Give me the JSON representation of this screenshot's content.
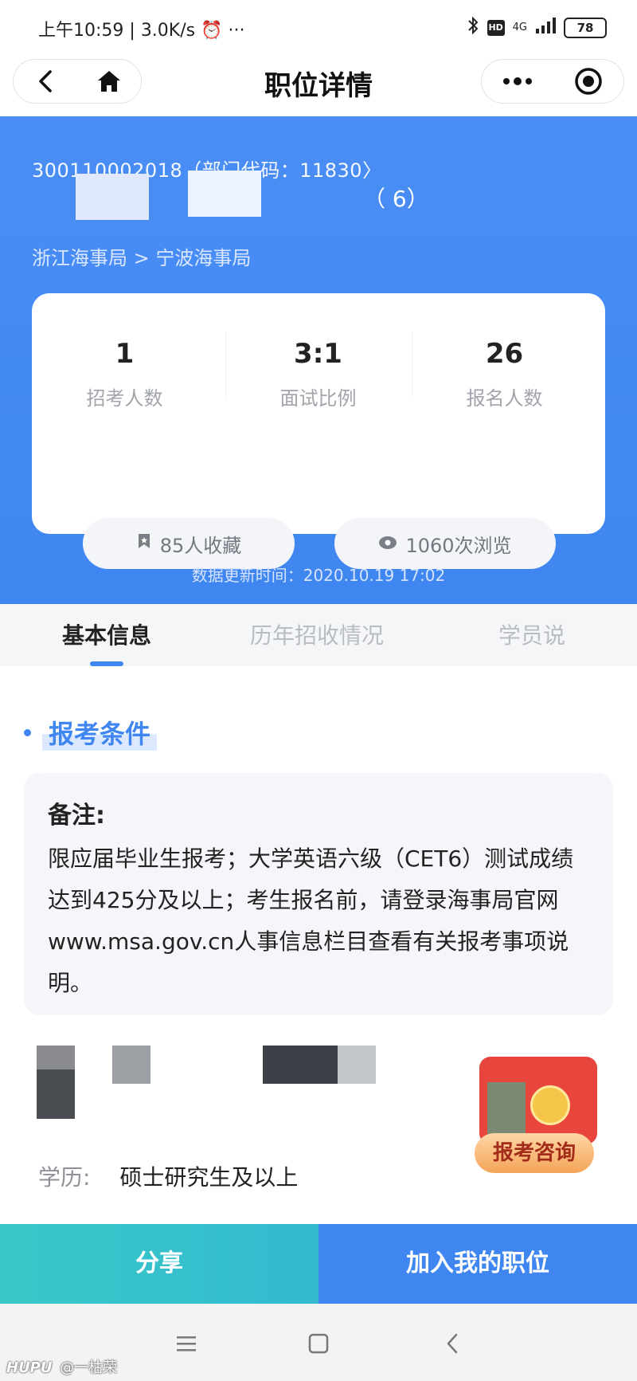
{
  "status_bar": {
    "time": "上午10:59",
    "network_speed": "3.0K/s",
    "network_type": "4G",
    "hd_label": "HD",
    "battery": "78"
  },
  "nav": {
    "title": "职位详情"
  },
  "header": {
    "job_code": "300110002018（部门代码：11830〉",
    "title_tail": "（ 6）",
    "breadcrumb": "浙江海事局 > 宁波海事局"
  },
  "stats": {
    "items": [
      {
        "value": "1",
        "label": "招考人数"
      },
      {
        "value": "3:1",
        "label": "面试比例"
      },
      {
        "value": "26",
        "label": "报名人数"
      }
    ],
    "favorites": "85人收藏",
    "views": "1060次浏览"
  },
  "update_time": "数据更新时间：2020.10.19 17:02",
  "tabs": [
    {
      "label": "基本信息",
      "active": true
    },
    {
      "label": "历年招收情况",
      "active": false
    },
    {
      "label": "学员说",
      "active": false
    }
  ],
  "section": {
    "title": "报考条件",
    "note_title": "备注:",
    "note_text": "限应届毕业生报考；大学英语六级（CET6）测试成绩达到425分及以上；考生报名前，请登录海事局官网www.msa.gov.cn人事信息栏目查看有关报考事项说明。",
    "education_label": "学历:",
    "education_value": "硕士研究生及以上"
  },
  "consult": {
    "label": "报考咨询"
  },
  "actions": {
    "share": "分享",
    "add": "加入我的职位"
  },
  "watermark": {
    "logo": "HUPU",
    "user": "@一枯荣"
  },
  "colors": {
    "primary": "#3f86f1",
    "share": "#38c9c8",
    "consult": "#e8453d"
  }
}
